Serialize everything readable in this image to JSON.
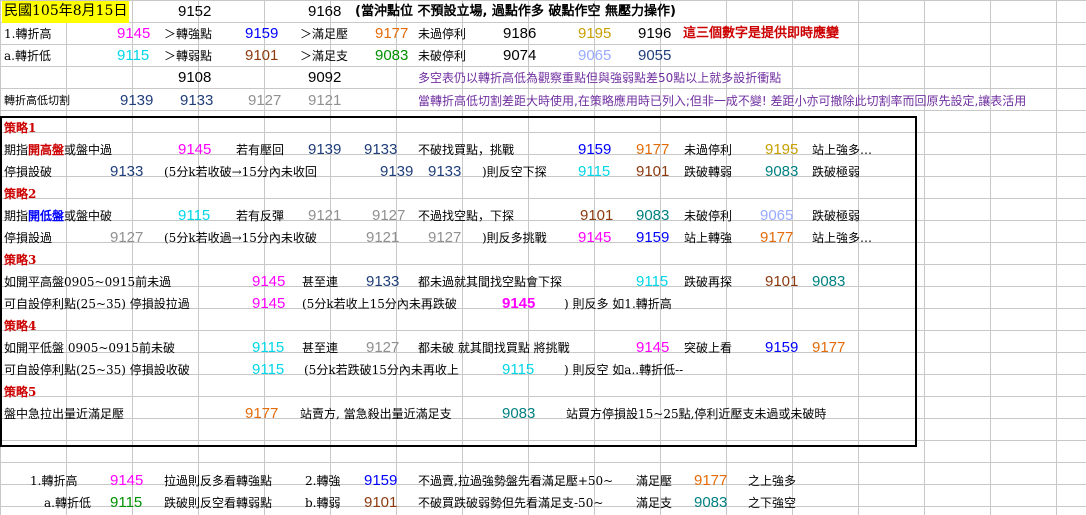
{
  "header": {
    "date_label": "民國105年8月15日",
    "ref1": "9152",
    "ref2": "9168",
    "note": "(當沖點位 不預設立場, 過點作多 破點作空 無壓力操作)"
  },
  "row1": {
    "label": "1.轉折高",
    "v1": "9145",
    "strong_label": "＞轉強點",
    "v2": "9159",
    "resist_label": "＞滿足壓",
    "v3": "9177",
    "stop_label": "未過停利",
    "v4": "9186",
    "v5": "9195",
    "v6": "9196",
    "note": "這三個數字是提供即時應變"
  },
  "row2": {
    "label": "a.轉折低",
    "v1": "9115",
    "weak_label": "＞轉弱點",
    "v2": "9101",
    "support_label": "＞滿足支",
    "v3": "9083",
    "stop_label": "未破停利",
    "v4": "9074",
    "v5": "9065",
    "v6": "9055"
  },
  "row3": {
    "v1": "9108",
    "v2": "9092",
    "note": "多空表仍以轉折高低為觀察重點但與強弱點差50點以上就多設折衝點"
  },
  "row4": {
    "label": "轉折高低切割",
    "v1": "9139",
    "v2": "9133",
    "v3": "9127",
    "v4": "9121",
    "note": "當轉折高低切割差距大時使用,在策略應用時已列入;但非一成不變! 差距小亦可撤除此切割率而回原先設定,讓表活用"
  },
  "s1": {
    "title": "策略1",
    "r1": {
      "pre": "期指",
      "hl": "開高盤",
      "post": "或盤中過",
      "v1": "9145",
      "pullback": "若有壓回",
      "v2": "9139",
      "v3": "9133",
      "act": "不破找買點，挑戰",
      "v4": "9159",
      "v5": "9177",
      "stop": "未過停利",
      "v6": "9195",
      "tail": "站上強多…"
    },
    "r2": {
      "label": "停損設破",
      "v1": "9133",
      "cond": "(5分k若收破→15分內未收回",
      "v2": "9139",
      "v3": "9133",
      "act": ")則反空下探",
      "v4": "9115",
      "v5": "9101",
      "mid": "跌破轉弱",
      "v6": "9083",
      "tail": "跌破極弱"
    }
  },
  "s2": {
    "title": "策略2",
    "r1": {
      "pre": "期指",
      "hl": "開低盤",
      "post": "或盤中破",
      "v1": "9115",
      "bounce": "若有反彈",
      "v2": "9121",
      "v3": "9127",
      "act": "不過找空點，下探",
      "v4": "9101",
      "v5": "9083",
      "stop": "未破停利",
      "v6": "9065",
      "tail": "跌破極弱"
    },
    "r2": {
      "label": "停損設過",
      "v1": "9127",
      "cond": "(5分k若收過→15分內未收破",
      "v2": "9121",
      "v3": "9127",
      "act": ")則反多挑戰",
      "v4": "9145",
      "v5": "9159",
      "mid": "站上轉強",
      "v6": "9177",
      "tail": "站上強多…"
    }
  },
  "s3": {
    "title": "策略3",
    "r1": {
      "label": "如開平高盤0905~0915前未過",
      "v1": "9145",
      "mid": "甚至連",
      "v2": "9133",
      "act": "都未過就其間找空點會下探",
      "v3": "9115",
      "act2": "跌破再探",
      "v4": "9101",
      "v5": "9083"
    },
    "r2": {
      "label": "可自設停利點(25~35) 停損設拉過",
      "v1": "9145",
      "cond": "(5分k若收上15分內未再跌破",
      "v2": "9145",
      "tail": ") 則反多 如1.轉折高"
    }
  },
  "s4": {
    "title": "策略4",
    "r1": {
      "label": "如開平低盤 0905~0915前未破",
      "v1": "9115",
      "mid": "甚至連",
      "v2": "9127",
      "act": "都未破 就其間找買點 將挑戰",
      "v3": "9145",
      "act2": "突破上看",
      "v4": "9159",
      "v5": "9177"
    },
    "r2": {
      "label": "可自設停利點(25~35) 停損設收破",
      "v1": "9115",
      "cond": "(5分k若跌破15分內未再收上",
      "v2": "9115",
      "tail": ") 則反空 如a..轉折低--"
    }
  },
  "s5": {
    "title": "策略5",
    "r1": {
      "label": "盤中急拉出量近滿足壓",
      "v1": "9177",
      "act": "站賣方, 當急殺出量近滿足支",
      "v2": "9083",
      "tail": "站買方停損設15~25點,停利近壓支未過或未破時"
    }
  },
  "summary": {
    "r1": {
      "label": "1.轉折高",
      "v1": "9145",
      "t1": "拉過則反多看轉強點",
      "label2": "2.轉強",
      "v2": "9159",
      "t2": "不過賣,拉過強勢盤先看滿足壓+50~",
      "t3": "滿足壓",
      "v3": "9177",
      "t4": "之上強多"
    },
    "r2": {
      "label": "a.轉折低",
      "v1": "9115",
      "t1": "跌破則反空看轉弱點",
      "label2": "b.轉弱",
      "v2": "9101",
      "t2": "不破買跌破弱勢但先看滿足支-50~",
      "t3": "滿足支",
      "v3": "9083",
      "t4": "之下強空"
    }
  },
  "colors": {
    "yellow_header": "#ffff00",
    "magenta": "#ff00ff",
    "cyan": "#00d7e8",
    "navy": "#1f3d7a",
    "grey": "#909090",
    "orange": "#e36c09",
    "brown": "#8b3a0f",
    "green": "#009000",
    "teal": "#008080",
    "purple": "#7030a0",
    "red": "#cc0000",
    "blue": "#0000ff"
  }
}
